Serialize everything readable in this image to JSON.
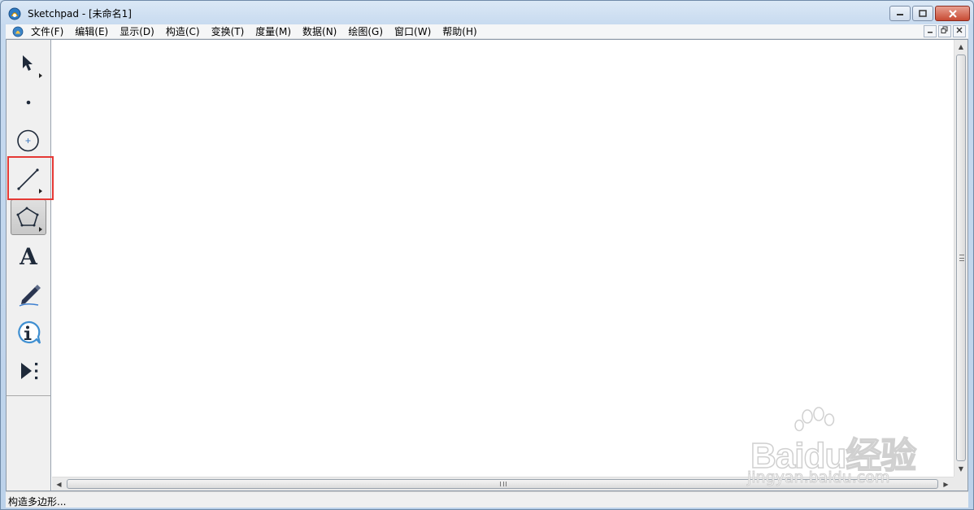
{
  "window": {
    "title": "Sketchpad  - [未命名1]",
    "controls": [
      "minimize",
      "maximize",
      "close"
    ]
  },
  "menubar": {
    "items": [
      "文件(F)",
      "编辑(E)",
      "显示(D)",
      "构造(C)",
      "变换(T)",
      "度量(M)",
      "数据(N)",
      "绘图(G)",
      "窗口(W)",
      "帮助(H)"
    ]
  },
  "toolbox": {
    "tools": [
      {
        "name": "selection-arrow-tool",
        "icon": "arrow-icon",
        "has_submenu": true
      },
      {
        "name": "point-tool",
        "icon": "point-icon",
        "has_submenu": false
      },
      {
        "name": "compass-tool",
        "icon": "circle-icon",
        "has_submenu": false
      },
      {
        "name": "straightedge-tool",
        "icon": "line-segment-icon",
        "has_submenu": true
      },
      {
        "name": "polygon-tool",
        "icon": "pentagon-icon",
        "has_submenu": true,
        "selected": true
      },
      {
        "name": "text-tool",
        "icon": "letter-a-icon",
        "has_submenu": false
      },
      {
        "name": "marker-tool",
        "icon": "marker-pen-icon",
        "has_submenu": false
      },
      {
        "name": "information-tool",
        "icon": "info-icon",
        "has_submenu": false
      },
      {
        "name": "custom-tools",
        "icon": "play-more-icon",
        "has_submenu": false
      }
    ],
    "text_tool_glyph": "A",
    "highlight_color": "#e53935"
  },
  "statusbar": {
    "text": "构造多边形..."
  },
  "watermark": {
    "logo": "Baidu经验",
    "url": "jingyan.baidu.com"
  }
}
